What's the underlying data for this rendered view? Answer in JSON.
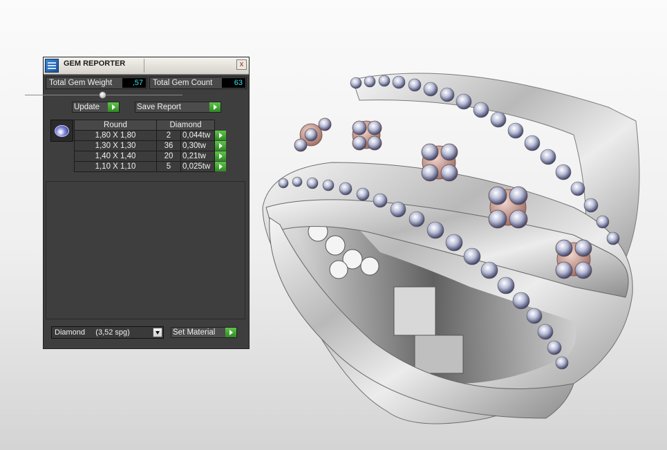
{
  "panel": {
    "title": "GEM REPORTER",
    "close_glyph": "x",
    "total_weight_label": "Total Gem Weight",
    "total_weight_value": ",57",
    "total_count_label": "Total Gem Count",
    "total_count_value": "63",
    "update_label": "Update",
    "save_report_label": "Save Report",
    "gem_icon": "round-gem-icon",
    "table": {
      "headers": [
        "Round",
        "Diamond"
      ],
      "rows": [
        {
          "size": "1,80 X 1,80",
          "count": "2",
          "weight": "0,044tw"
        },
        {
          "size": "1,30 X 1,30",
          "count": "36",
          "weight": "0,30tw"
        },
        {
          "size": "1,40 X 1,40",
          "count": "20",
          "weight": "0,21tw"
        },
        {
          "size": "1,10 X 1,10",
          "count": "5",
          "weight": "0,025tw"
        }
      ]
    },
    "material_select_value": "Diamond     (3,52 spg)",
    "set_material_label": "Set Material"
  },
  "colors": {
    "panel_bg": "#3e3e3e",
    "value_text": "#3fe0f0",
    "go_button": "#3fa82e",
    "metal": "#c9c9c9",
    "rose_gold": "#b98a80"
  },
  "viewport": {
    "object": "ring-render",
    "metal": "white gold with rose gold prong clusters"
  }
}
